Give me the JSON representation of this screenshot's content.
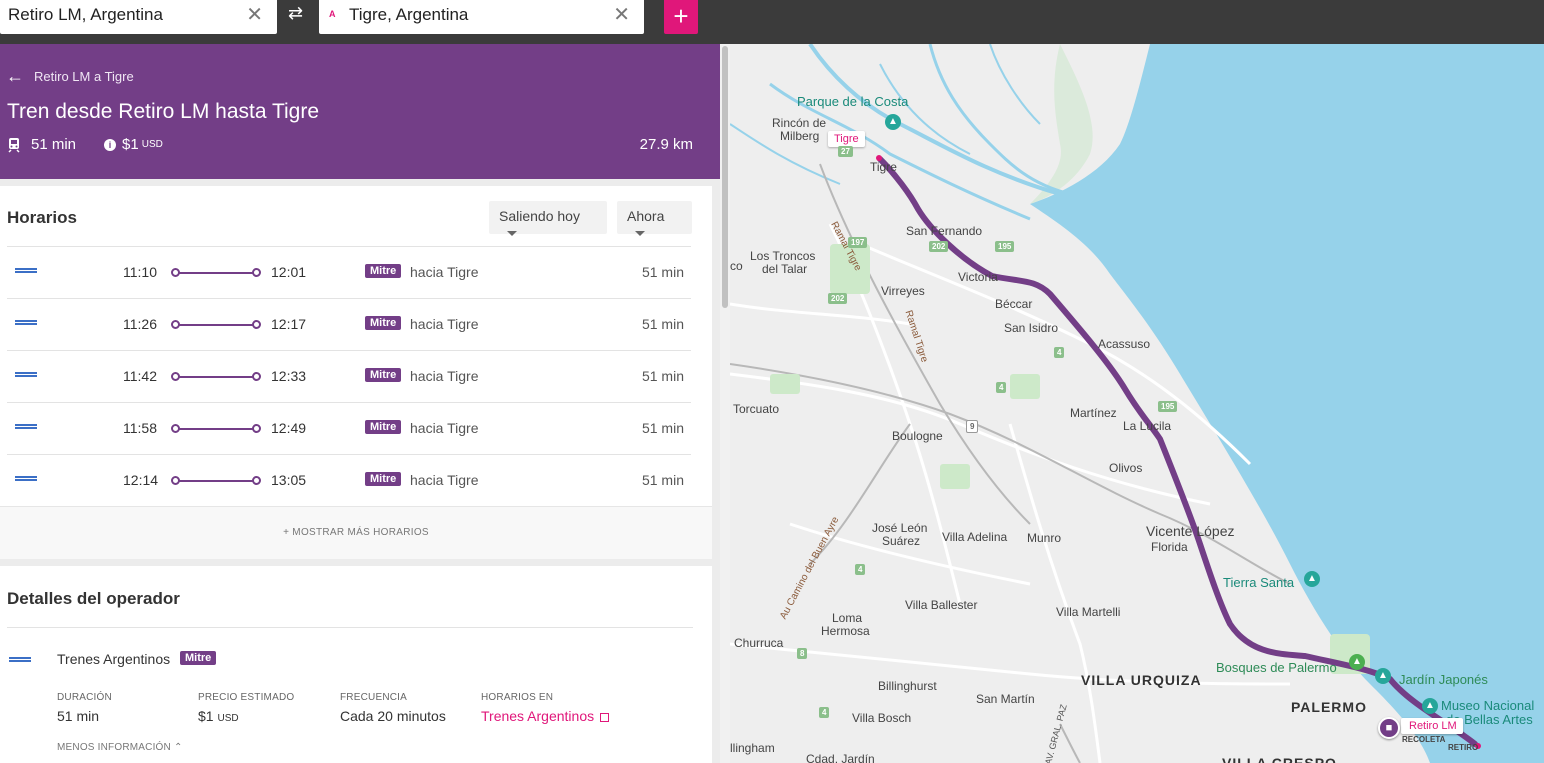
{
  "search": {
    "origin": "Retiro LM, Argentina",
    "destination": "Tigre, Argentina",
    "destination_marker": "A",
    "clear_glyph": "✕",
    "swap_glyph": "⇄",
    "add_glyph": "+"
  },
  "header": {
    "breadcrumb": "Retiro LM a Tigre",
    "title": "Tren desde Retiro LM hasta Tigre",
    "duration": "51 min",
    "price": "$1",
    "price_unit": "USD",
    "distance": "27.9 km",
    "colors": {
      "bg": "#733e87"
    }
  },
  "schedules": {
    "heading": "Horarios",
    "leaving_select": "Saliendo hoy",
    "time_select": "Ahora",
    "rows": [
      {
        "dep": "11:10",
        "arr": "12:01",
        "line": "Mitre",
        "towards": "hacia Tigre",
        "duration": "51 min"
      },
      {
        "dep": "11:26",
        "arr": "12:17",
        "line": "Mitre",
        "towards": "hacia Tigre",
        "duration": "51 min"
      },
      {
        "dep": "11:42",
        "arr": "12:33",
        "line": "Mitre",
        "towards": "hacia Tigre",
        "duration": "51 min"
      },
      {
        "dep": "11:58",
        "arr": "12:49",
        "line": "Mitre",
        "towards": "hacia Tigre",
        "duration": "51 min"
      },
      {
        "dep": "12:14",
        "arr": "13:05",
        "line": "Mitre",
        "towards": "hacia Tigre",
        "duration": "51 min"
      }
    ],
    "show_more": "+ MOSTRAR MÁS HORARIOS"
  },
  "operator": {
    "heading": "Detalles del operador",
    "name": "Trenes Argentinos",
    "line": "Mitre",
    "duration_label": "DURACIÓN",
    "duration_value": "51 min",
    "price_label": "PRECIO ESTIMADO",
    "price_value": "$1",
    "price_unit": "USD",
    "frequency_label": "FRECUENCIA",
    "frequency_value": "Cada 20 minutos",
    "schedules_label": "HORARIOS EN",
    "schedules_link": "Trenes Argentinos",
    "less_info": "MENOS INFORMACIÓN"
  },
  "map": {
    "route_color": "#733e87",
    "water_color": "#96d2ea",
    "origin_chip": "Retiro LM",
    "destination_chip": "Tigre",
    "labels": {
      "parque_costa": "Parque de la Costa",
      "rincon1": "Rincón de",
      "rincon2": "Milberg",
      "tigre": "Tigre",
      "san_fernando": "San Fernando",
      "troncos1": "Los Troncos",
      "troncos2": "del Talar",
      "co": "co",
      "victoria": "Victoria",
      "virreyes": "Virreyes",
      "beccar": "Béccar",
      "san_isidro": "San Isidro",
      "acassuso": "Acassuso",
      "torcuato": "Torcuato",
      "martinez": "Martínez",
      "la_lucila": "La Lucila",
      "boulogne": "Boulogne",
      "olivos": "Olivos",
      "jose_leon1": "José León",
      "jose_leon2": "Suárez",
      "villa_adelina": "Villa Adelina",
      "munro": "Munro",
      "vicente_lopez": "Vicente López",
      "florida": "Florida",
      "tierra_santa": "Tierra Santa",
      "villa_ballester": "Villa Ballester",
      "villa_martelli": "Villa Martelli",
      "churruca": "Churruca",
      "loma1": "Loma",
      "loma2": "Hermosa",
      "bosques": "Bosques de Palermo",
      "jardin": "Jardín Japonés",
      "museo1": "Museo Nacional",
      "museo2": "de Bellas Artes",
      "billinghurst": "Billinghurst",
      "san_martin": "San Martín",
      "villa_urquiza": "VILLA URQUIZA",
      "palermo": "PALERMO",
      "villa_bosch": "Villa Bosch",
      "hurlingham": "llingham",
      "cdad_jardin": "Cdad. Jardín",
      "recoleta": "RECOLETA",
      "retiro": "RETIRO",
      "villa_crespo": "VILLA CRESPO",
      "ramal_tigre1": "Ramal Tigre",
      "ramal_tigre2": "Ramal Tigre",
      "camino_buen_ayre": "Au Camino del Buen Ayre",
      "gral_paz": "AV. GRAL. PAZ"
    },
    "shields": [
      "197",
      "202",
      "195",
      "202",
      "4",
      "4",
      "195",
      "9",
      "4",
      "8",
      "4",
      "27"
    ]
  }
}
